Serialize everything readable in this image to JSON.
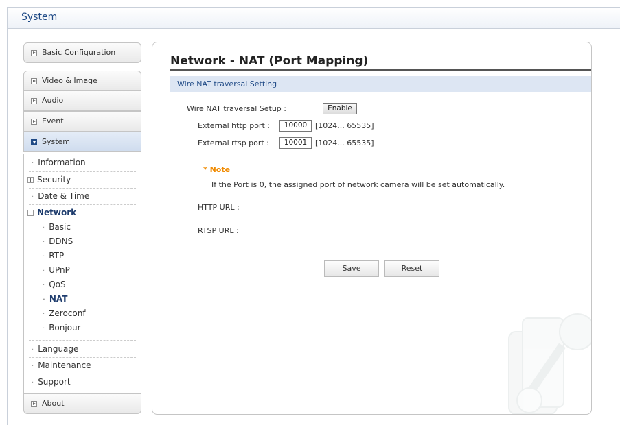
{
  "header": {
    "title": "System"
  },
  "sidebar": {
    "basic_config": "Basic Configuration",
    "video_image": "Video & Image",
    "audio": "Audio",
    "event": "Event",
    "system": "System",
    "about": "About",
    "system_items": {
      "information": "Information",
      "security": "Security",
      "date_time": "Date & Time",
      "network": "Network",
      "language": "Language",
      "maintenance": "Maintenance",
      "support": "Support"
    },
    "network_items": {
      "basic": "Basic",
      "ddns": "DDNS",
      "rtp": "RTP",
      "upnp": "UPnP",
      "qos": "QoS",
      "nat": "NAT",
      "zeroconf": "Zeroconf",
      "bonjour": "Bonjour"
    }
  },
  "main": {
    "title": "Network - NAT (Port Mapping)",
    "section_title": "Wire NAT traversal Setting",
    "setup_label": "Wire NAT traversal Setup :",
    "enable_button": "Enable",
    "http_port_label": "External http port :",
    "http_port_value": "10000",
    "http_port_range": "[1024... 65535]",
    "rtsp_port_label": "External rtsp port :",
    "rtsp_port_value": "10001",
    "rtsp_port_range": "[1024... 65535]",
    "note_title": "* Note",
    "note_text": "If the Port is 0, the assigned port of network camera will be set automatically.",
    "http_url_label": "HTTP URL :",
    "rtsp_url_label": "RTSP URL :",
    "save_button": "Save",
    "reset_button": "Reset"
  },
  "colors": {
    "accent": "#1f4a86",
    "note": "#f08a00",
    "section_bg": "#dde6f3"
  }
}
